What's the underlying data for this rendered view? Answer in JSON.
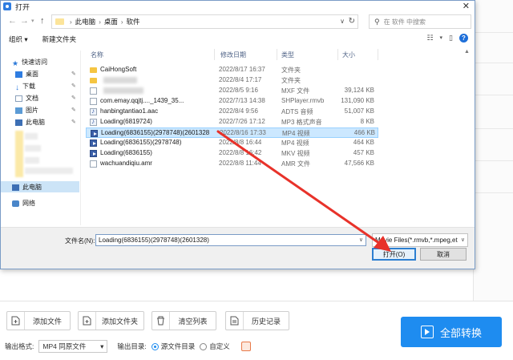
{
  "dialog": {
    "title": "打开",
    "close": "✕",
    "address": {
      "parts": [
        "此电脑",
        "桌面",
        "软件"
      ],
      "separator": "›"
    },
    "search": {
      "placeholder": "在 软件 中搜索"
    },
    "toolbar": {
      "organize": "组织 ▾",
      "new_folder": "新建文件夹"
    },
    "nav_pane": {
      "quick_access": "快速访问",
      "desktop": "桌面",
      "downloads": "下载",
      "documents": "文档",
      "pictures": "图片",
      "this_pc_quick": "此电脑",
      "this_pc": "此电脑",
      "network": "网络"
    },
    "columns": {
      "name": "名称",
      "date": "修改日期",
      "type": "类型",
      "size": "大小"
    },
    "files": [
      {
        "name": "CaiHongSoft",
        "date": "2022/8/17 16:37",
        "type": "文件夹",
        "size": "",
        "icon": "folder"
      },
      {
        "name": "",
        "date": "2022/8/4 17:17",
        "type": "文件夹",
        "size": "",
        "icon": "folder"
      },
      {
        "name": "",
        "date": "2022/8/5 9:16",
        "type": "MXF 文件",
        "size": "39,124 KB",
        "icon": "doc"
      },
      {
        "name": "com.emay.qqjtj...._1439_35...",
        "date": "2022/7/13 14:38",
        "type": "SHPlayer.rmvb",
        "size": "131,090 KB",
        "icon": "doc"
      },
      {
        "name": "hanbingtantiao1.aac",
        "date": "2022/8/4 9:56",
        "type": "ADTS 音频",
        "size": "51,007 KB",
        "icon": "audio"
      },
      {
        "name": "Loading(6819724)",
        "date": "2022/7/26 17:12",
        "type": "MP3 格式声音",
        "size": "8 KB",
        "icon": "audio"
      },
      {
        "name": "Loading(6836155)(2978748)(2601328)",
        "date": "2022/8/16 17:33",
        "type": "MP4 视频",
        "size": "466 KB",
        "icon": "mp4",
        "selected": true
      },
      {
        "name": "Loading(6836155)(2978748)",
        "date": "2022/8/8 16:44",
        "type": "MP4 视频",
        "size": "464 KB",
        "icon": "mp4"
      },
      {
        "name": "Loading(6836155)",
        "date": "2022/8/8 16:42",
        "type": "MKV 视频",
        "size": "457 KB",
        "icon": "mp4"
      },
      {
        "name": "wachuandiqiu.amr",
        "date": "2022/8/8 11:44",
        "type": "AMR 文件",
        "size": "47,566 KB",
        "icon": "audio"
      }
    ],
    "filename_label": "文件名(N):",
    "filename_value": "Loading(6836155)(2978748)(2601328)",
    "filetype_value": "Movie Files(*.rmvb,*.mpeg,et",
    "open_button": "打开(O)",
    "cancel_button": "取消"
  },
  "app": {
    "buttons": {
      "add_file": "添加文件",
      "add_folder": "添加文件夹",
      "clear_list": "清空列表",
      "history": "历史记录"
    },
    "convert": "全部转换",
    "output_format_label": "输出格式:",
    "output_format_value": "MP4 同原文件",
    "output_dir_label": "输出目录:",
    "output_dir_source": "源文件目录",
    "output_dir_custom": "自定义"
  },
  "colors": {
    "accent": "#1e8cf0",
    "selection": "#cce8ff",
    "annotation_arrow": "#e8322a"
  }
}
